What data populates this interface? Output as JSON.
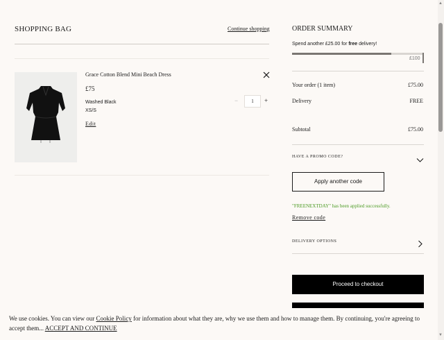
{
  "bag": {
    "title": "SHOPPING BAG",
    "continue_label": "Continue shopping"
  },
  "item": {
    "name": "Grace Cotton Blend Mini Beach Dress",
    "price": "£75",
    "colour": "Washed Black",
    "size": "XS/S",
    "edit_label": "Edit",
    "quantity": "1",
    "qty_minus": "−",
    "qty_plus": "+"
  },
  "summary": {
    "title": "ORDER SUMMARY",
    "spend_prefix": "Spend another £25.00 for ",
    "spend_bold": "free",
    "spend_suffix": " delivery!",
    "progress_target": "£100",
    "progress_fraction": 0.75,
    "order_label": "Your order (1 item)",
    "order_value": "£75.00",
    "delivery_label": "Delivery",
    "delivery_value": "FREE",
    "subtotal_label": "Subtotal",
    "subtotal_value": "£75.00",
    "promo_label": "HAVE A PROMO CODE?",
    "apply_label": "Apply another code",
    "promo_success": "\"FREENEXTDAY\" has been applied successfully.",
    "remove_code_label": "Remove code",
    "delivery_options_label": "DELIVERY OPTIONS",
    "checkout_label": "Proceed to checkout"
  },
  "cookie": {
    "text_1": "We use cookies. You can view our ",
    "policy_link": "Cookie Policy",
    "text_2": " for information about what they are, why we use them and how to manage them. By continuing, you're agreeing to accept them... ",
    "accept_link": "ACCEPT AND CONTINUE"
  },
  "colors": {
    "background": "#fcf9f6",
    "success": "#4a9a22",
    "primary_button": "#000000"
  },
  "icons": {
    "remove_item": "close-icon",
    "promo_toggle": "chevron-down-icon",
    "delivery_options": "chevron-right-icon"
  }
}
